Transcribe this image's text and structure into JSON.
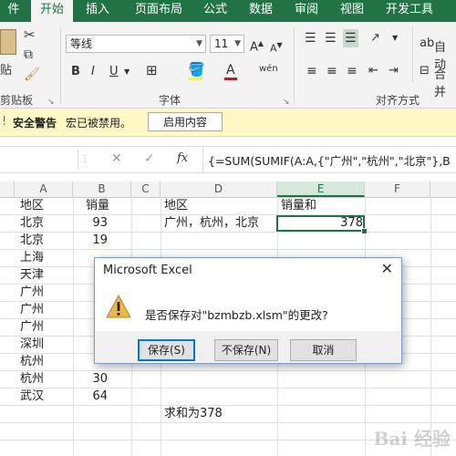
{
  "ribbon_tabs": [
    "件",
    "开始",
    "插入",
    "页面布局",
    "公式",
    "数据",
    "审阅",
    "视图",
    "开发工具"
  ],
  "ribbon": {
    "paste_label": "贴",
    "clipboard_label": "剪贴板",
    "font_name": "等线",
    "font_size": "11",
    "font_group_label": "字体",
    "align_group_label": "对齐方式",
    "wrap_label": "自动",
    "merge_label": "合并"
  },
  "security_bar": {
    "title": "安全警告",
    "message": "宏已被禁用。",
    "enable_button": "启用内容"
  },
  "formula_bar": {
    "fx": "fx",
    "formula": "{=SUM(SUMIF(A:A,{\"广州\",\"杭州\",\"北京\"},B"
  },
  "columns": [
    "A",
    "B",
    "C",
    "D",
    "E",
    "F"
  ],
  "selected_column": "E",
  "sheet": {
    "headers": {
      "a": "地区",
      "b": "销量",
      "d": "地区",
      "e": "销量和"
    },
    "criteria_text": "广州，杭州，北京",
    "result_value": "378",
    "sum_note": "求和为378",
    "rows": [
      {
        "region": "北京",
        "sales": "93"
      },
      {
        "region": "北京",
        "sales": "19"
      },
      {
        "region": "上海",
        "sales": ""
      },
      {
        "region": "天津",
        "sales": ""
      },
      {
        "region": "广州",
        "sales": ""
      },
      {
        "region": "广州",
        "sales": ""
      },
      {
        "region": "广州",
        "sales": ""
      },
      {
        "region": "深圳",
        "sales": ""
      },
      {
        "region": "杭州",
        "sales": ""
      },
      {
        "region": "杭州",
        "sales": "30"
      },
      {
        "region": "武汉",
        "sales": "64"
      }
    ]
  },
  "dialog": {
    "title": "Microsoft Excel",
    "message": "是否保存对\"bzmbzb.xlsm\"的更改?",
    "save_button": "保存(S)",
    "dont_save_button": "不保存(N)",
    "cancel_button": "取消",
    "close_glyph": "✕"
  },
  "colors": {
    "excel_green": "#217346",
    "security_bar": "#fff8c5",
    "warning_icon": "#e8b84a"
  }
}
